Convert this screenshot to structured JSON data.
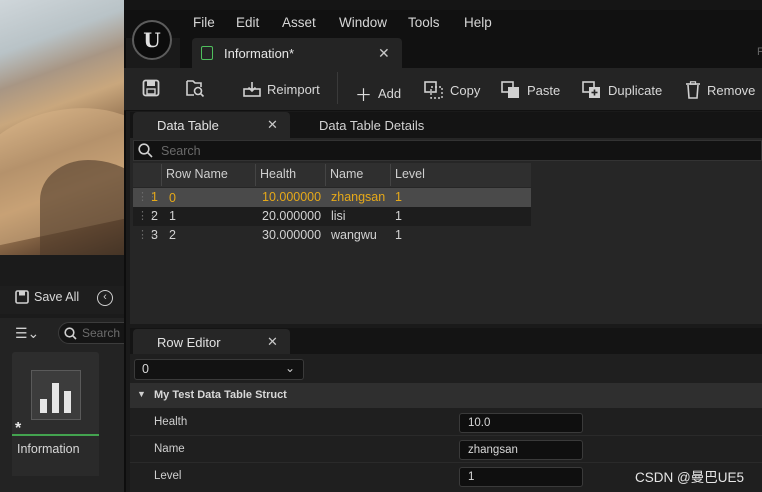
{
  "menu": [
    "File",
    "Edit",
    "Asset",
    "Window",
    "Tools",
    "Help"
  ],
  "doc_tab": {
    "label": "Information*"
  },
  "toolbar": {
    "reimport": "Reimport",
    "add": "Add",
    "copy": "Copy",
    "paste": "Paste",
    "duplicate": "Duplicate",
    "remove": "Remove"
  },
  "data_table": {
    "tab_label": "Data Table",
    "details_tab_label": "Data Table Details",
    "search_placeholder": "Search",
    "columns": [
      "Row Name",
      "Health",
      "Name",
      "Level"
    ],
    "rows": [
      {
        "index": "1",
        "row_name": "0",
        "health": "10.000000",
        "name": "zhangsan",
        "level": "1",
        "selected": true
      },
      {
        "index": "2",
        "row_name": "1",
        "health": "20.000000",
        "name": "lisi",
        "level": "1",
        "selected": false
      },
      {
        "index": "3",
        "row_name": "2",
        "health": "30.000000",
        "name": "wangwu",
        "level": "1",
        "selected": false
      }
    ]
  },
  "row_editor": {
    "tab_label": "Row Editor",
    "selected_row": "0",
    "struct_name": "My Test Data Table Struct",
    "props": [
      {
        "label": "Health",
        "value": "10.0"
      },
      {
        "label": "Name",
        "value": "zhangsan"
      },
      {
        "label": "Level",
        "value": "1"
      }
    ]
  },
  "content_browser": {
    "save_all": "Save All",
    "search_placeholder": "Search",
    "asset_label": "Information"
  },
  "watermark": "CSDN @曼巴UE5",
  "colors": {
    "selected_text": "#e6a919",
    "asset_accent": "#43a34f"
  }
}
